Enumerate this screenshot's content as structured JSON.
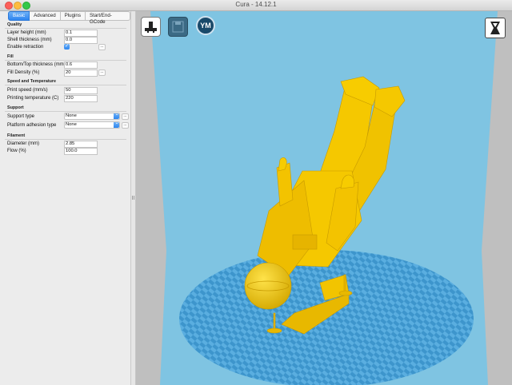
{
  "window": {
    "title": "Cura - 14.12.1"
  },
  "tabs": [
    {
      "label": "Basic",
      "active": true
    },
    {
      "label": "Advanced",
      "active": false
    },
    {
      "label": "Plugins",
      "active": false
    },
    {
      "label": "Start/End-GCode",
      "active": false
    }
  ],
  "quality": {
    "heading": "Quality",
    "layer_height_label": "Layer height (mm)",
    "layer_height": "0.1",
    "shell_thickness_label": "Shell thickness (mm)",
    "shell_thickness": "0.0",
    "retraction_label": "Enable retraction",
    "retraction_checked": true,
    "more_button": "..."
  },
  "fill": {
    "heading": "Fill",
    "bottom_top_label": "Bottom/Top thickness (mm)",
    "bottom_top": "0.6",
    "density_label": "Fill Density (%)",
    "density": "20",
    "more_button": "..."
  },
  "speed": {
    "heading": "Speed and Temperature",
    "print_speed_label": "Print speed (mm/s)",
    "print_speed": "50",
    "temp_label": "Printing temperature (C)",
    "temp": "220"
  },
  "support": {
    "heading": "Support",
    "type_label": "Support type",
    "type": "None",
    "adhesion_label": "Platform adhesion type",
    "adhesion": "None",
    "more_button": "..."
  },
  "filament": {
    "heading": "Filament",
    "diameter_label": "Diameter (mm)",
    "diameter": "2.85",
    "flow_label": "Flow (%)",
    "flow": "100.0"
  },
  "toolbar": {
    "ym_label": "YM"
  },
  "colors": {
    "sky": "#7ec3e0",
    "wall": "#c8c8c8",
    "plate": "#4fa6d8",
    "model": "#f5c800",
    "accent": "#2e86f0"
  }
}
